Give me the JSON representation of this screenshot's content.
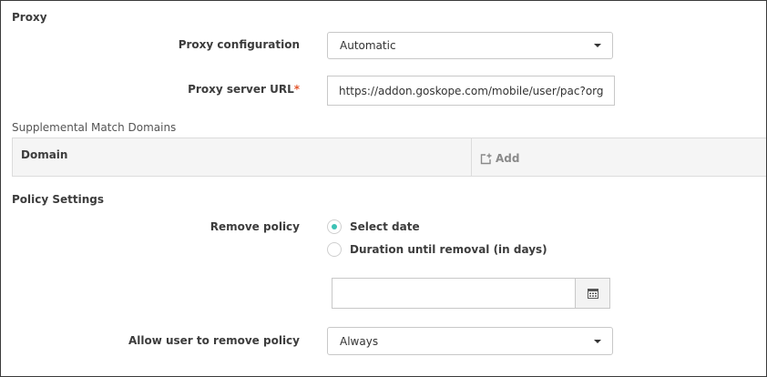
{
  "proxy": {
    "section_title": "Proxy",
    "configuration": {
      "label": "Proxy configuration",
      "value": "Automatic"
    },
    "server_url": {
      "label": "Proxy server URL",
      "required_mark": "*",
      "value": "https://addon.goskope.com/mobile/user/pac?org"
    }
  },
  "supplemental": {
    "title": "Supplemental Match Domains",
    "table": {
      "column_domain": "Domain",
      "add_label": "Add"
    }
  },
  "policy": {
    "section_title": "Policy Settings",
    "remove_policy": {
      "label": "Remove policy",
      "options": [
        {
          "label": "Select date",
          "selected": true
        },
        {
          "label": "Duration until removal (in days)",
          "selected": false
        }
      ],
      "date_value": ""
    },
    "allow_user_remove": {
      "label": "Allow user to remove policy",
      "value": "Always"
    }
  },
  "colors": {
    "accent_radio": "#3cc2b5",
    "required_mark": "#e4572e",
    "border": "#c8c8c8"
  },
  "icons": {
    "dropdown": "caret-down-icon",
    "add": "add-icon",
    "calendar": "calendar-icon"
  }
}
